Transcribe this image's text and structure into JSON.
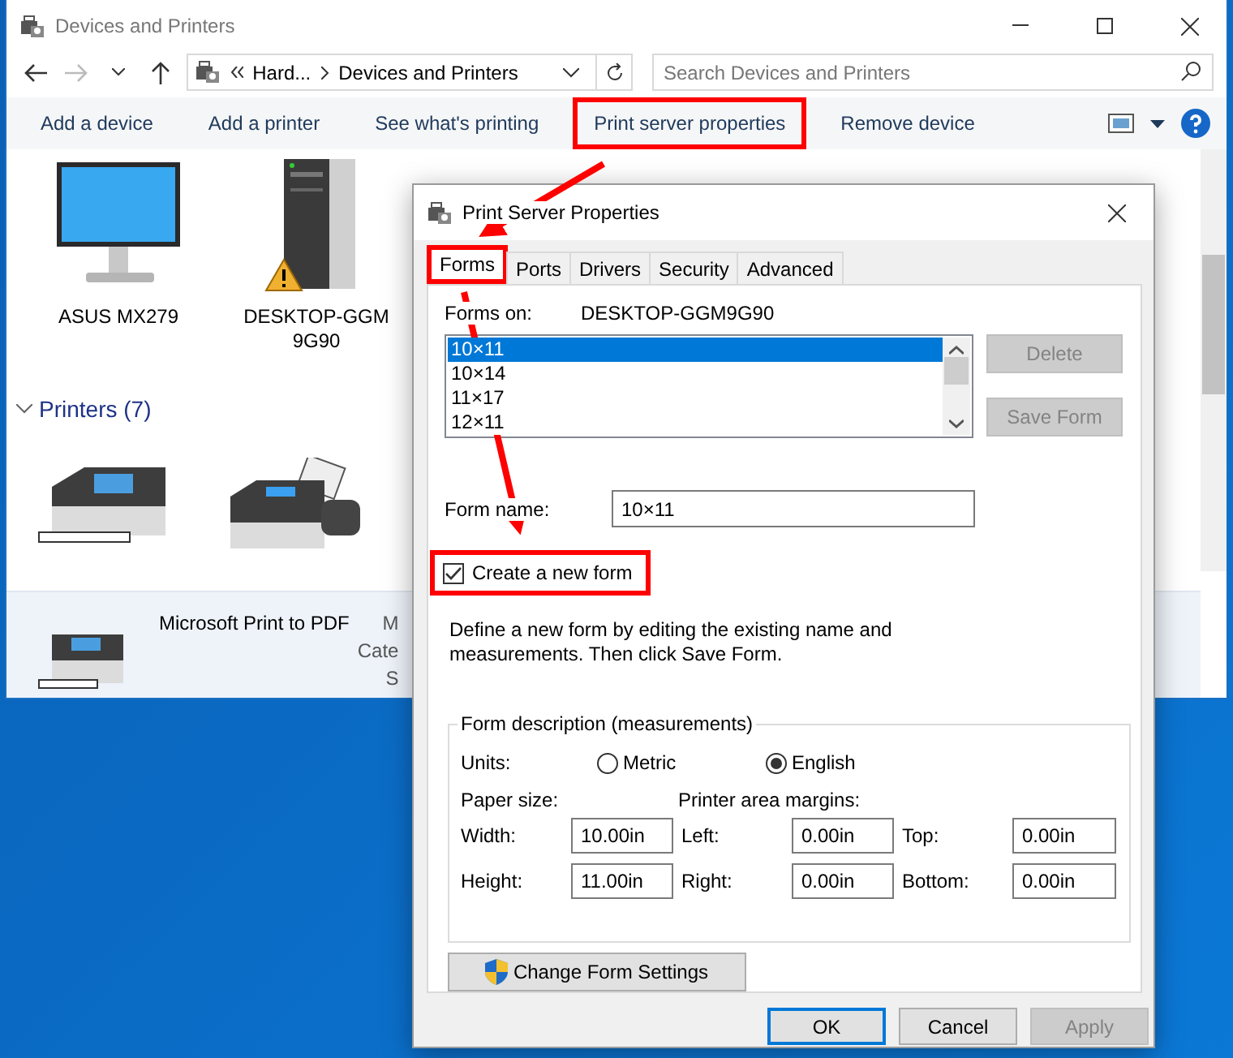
{
  "explorer": {
    "title": "Devices and Printers",
    "breadcrumb": [
      "Hard...",
      "Devices and Printers"
    ],
    "search": {
      "placeholder": "Search Devices and Printers"
    },
    "toolbar": [
      {
        "label": "Add a device",
        "highlighted": false
      },
      {
        "label": "Add a printer",
        "highlighted": false
      },
      {
        "label": "See what's printing",
        "highlighted": false
      },
      {
        "label": "Print server properties",
        "highlighted": true
      },
      {
        "label": "Remove device",
        "highlighted": false
      }
    ],
    "devices": [
      {
        "kind": "monitor",
        "name": "ASUS MX279",
        "warning": false
      },
      {
        "kind": "tower",
        "name": "DESKTOP-GGM9G90",
        "warning": true
      }
    ],
    "printers_group": {
      "label": "Printers (7)",
      "expanded": true
    },
    "printers": [
      {
        "kind": "printer"
      },
      {
        "kind": "fax"
      }
    ],
    "details": {
      "name": "Microsoft Print to PDF",
      "lines": [
        "M",
        "Cate",
        "S"
      ]
    }
  },
  "dialog": {
    "title": "Print Server Properties",
    "tabs": [
      {
        "label": "Forms",
        "selected": true,
        "highlighted": true
      },
      {
        "label": "Ports",
        "selected": false,
        "highlighted": false
      },
      {
        "label": "Drivers",
        "selected": false,
        "highlighted": false
      },
      {
        "label": "Security",
        "selected": false,
        "highlighted": false
      },
      {
        "label": "Advanced",
        "selected": false,
        "highlighted": false
      }
    ],
    "forms_on_label": "Forms on:",
    "server": "DESKTOP-GGM9G90",
    "forms": [
      {
        "label": "10×11",
        "selected": true
      },
      {
        "label": "10×14",
        "selected": false
      },
      {
        "label": "11×17",
        "selected": false
      },
      {
        "label": "12×11",
        "selected": false
      }
    ],
    "side_buttons": [
      {
        "label": "Delete",
        "disabled": true
      },
      {
        "label": "Save Form",
        "disabled": true
      }
    ],
    "form_name": {
      "label": "Form name:",
      "value": "10×11"
    },
    "create_new": {
      "label": "Create a new form",
      "checked": true,
      "highlighted": true
    },
    "description": "Define a new form by editing the existing name and measurements. Then click Save Form.",
    "group_title": "Form description (measurements)",
    "units_label": "Units:",
    "units": [
      {
        "label": "Metric",
        "selected": false
      },
      {
        "label": "English",
        "selected": true
      }
    ],
    "paper_size_label": "Paper size:",
    "margins_label": "Printer area margins:",
    "fields": [
      {
        "label": "Width:",
        "value": "10.00in"
      },
      {
        "label": "Left:",
        "value": "0.00in"
      },
      {
        "label": "Top:",
        "value": "0.00in"
      },
      {
        "label": "Height:",
        "value": "11.00in"
      },
      {
        "label": "Right:",
        "value": "0.00in"
      },
      {
        "label": "Bottom:",
        "value": "0.00in"
      }
    ],
    "change_button": "Change Form Settings",
    "buttons": [
      {
        "label": "OK",
        "default": true,
        "disabled": false
      },
      {
        "label": "Cancel",
        "default": false,
        "disabled": false
      },
      {
        "label": "Apply",
        "default": false,
        "disabled": true
      }
    ]
  }
}
